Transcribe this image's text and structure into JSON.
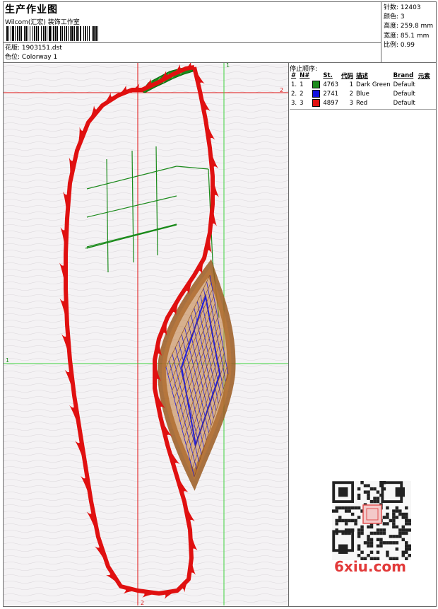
{
  "header": {
    "title": "生产作业图",
    "studio": "Wilcom(汇宏) 装饰工作室",
    "design_label": "花版:",
    "design_value": "1903151.dst",
    "colorway_label": "色位:",
    "colorway_value": "Colorway 1"
  },
  "stats": [
    {
      "label": "针数:",
      "value": "12403"
    },
    {
      "label": "颜色:",
      "value": "3"
    },
    {
      "label": "高度:",
      "value": "259.8 mm"
    },
    {
      "label": "宽度:",
      "value": "85.1 mm"
    },
    {
      "label": "比例:",
      "value": "0.99"
    }
  ],
  "canvas": {
    "marker_top_right": "1",
    "marker_right": "2",
    "marker_left": "1",
    "marker_bottom": "2"
  },
  "legend": {
    "title": "停止顺序:",
    "headers": {
      "index": "#",
      "number": "N#",
      "stitches": "St.",
      "code": "代码",
      "description": "描述",
      "brand": "Brand",
      "element": "元素"
    },
    "rows": [
      {
        "index": "1.",
        "number": "1",
        "color": "#1a8a1a",
        "stitches": "4763",
        "code": "1",
        "description": "Dark Green",
        "brand": "Default"
      },
      {
        "index": "2.",
        "number": "2",
        "color": "#1010e0",
        "stitches": "2741",
        "code": "2",
        "description": "Blue",
        "brand": "Default"
      },
      {
        "index": "3.",
        "number": "3",
        "color": "#e01010",
        "stitches": "4897",
        "code": "3",
        "description": "Red",
        "brand": "Default"
      }
    ]
  },
  "watermark": {
    "site": "6xiu.com"
  },
  "colors": {
    "outline_red": "#e01010",
    "grid_green": "#1a8a1a",
    "guide_green": "#3cd23c",
    "guide_red": "#e01010",
    "fill_blue": "#1010e0",
    "fill_brown": "#9a5a20"
  }
}
